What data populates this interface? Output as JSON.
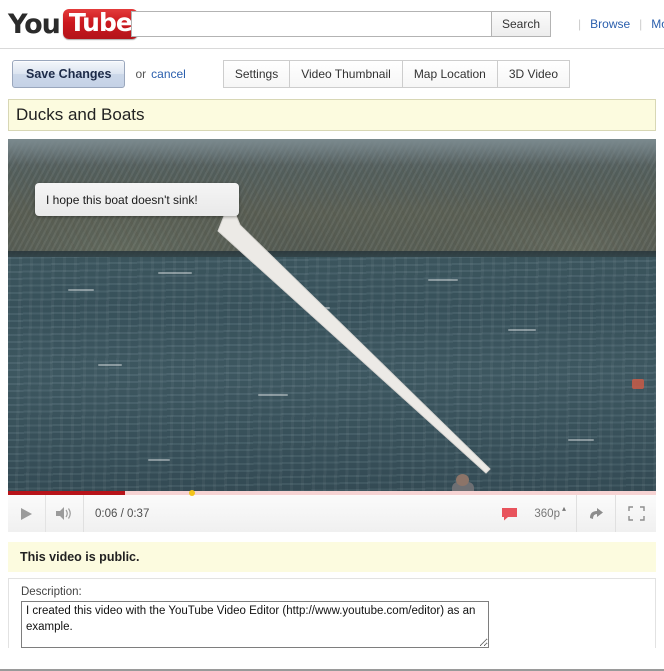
{
  "masthead": {
    "logo_you": "You",
    "logo_tube": "Tube",
    "search": {
      "value": "",
      "placeholder": ""
    },
    "search_button": "Search",
    "nav_links": [
      "Browse",
      "Mov"
    ]
  },
  "actionbar": {
    "save_label": "Save Changes",
    "or_text": "or",
    "cancel_label": "cancel",
    "tabs": [
      {
        "label": "Settings"
      },
      {
        "label": "Video Thumbnail"
      },
      {
        "label": "Map Location"
      },
      {
        "label": "3D Video"
      }
    ]
  },
  "video": {
    "title": "Ducks and Boats",
    "annotation_text": "I hope this boat doesn't sink!",
    "controls": {
      "play_icon": "play-icon",
      "volume_icon": "volume-icon",
      "time": "0:06 / 0:37",
      "captions_icon": "captions-icon",
      "quality": "360p",
      "quality_caret": "▴",
      "share_icon": "share-icon",
      "fullscreen_icon": "fullscreen-icon",
      "progress_percent": 18,
      "annotation_marker_percent": 28
    }
  },
  "privacy": {
    "status_text": "This video is public."
  },
  "description": {
    "label": "Description:",
    "value": "I created this video with the YouTube Video Editor (http://www.youtube.com/editor) as an example."
  },
  "colors": {
    "brand_red": "#cc181e",
    "link_blue": "#2b5fad",
    "highlight_yellow": "#fcfbdf",
    "progress_played": "#b7141a",
    "annotation_marker": "#f3c41a"
  }
}
